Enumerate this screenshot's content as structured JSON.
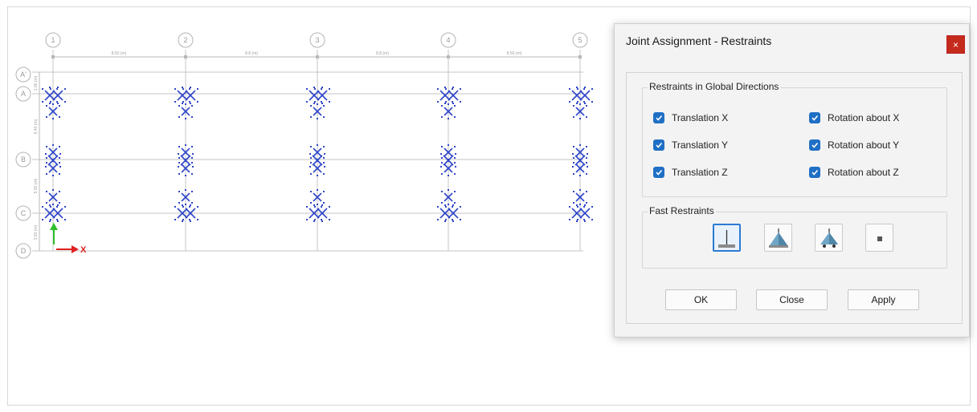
{
  "grid": {
    "columns": [
      "1",
      "2",
      "3",
      "4",
      "5"
    ],
    "rows": [
      "A'",
      "A",
      "B",
      "C",
      "D"
    ],
    "spans": [
      "8.50 (m)",
      "8.8 (m)",
      "8.8 (m)",
      "8.50 (m)"
    ],
    "row_spans": [
      "1.00 (m)",
      "6.40 (m)",
      "5.50 (m)",
      "3.50 (m)"
    ],
    "axis_x": "X"
  },
  "dialog": {
    "title": "Joint Assignment - Restraints",
    "close_glyph": "×",
    "group_global": "Restraints in Global Directions",
    "checks": [
      {
        "label": "Translation  X",
        "checked": true
      },
      {
        "label": "Translation  Y",
        "checked": true
      },
      {
        "label": "Translation  Z",
        "checked": true
      },
      {
        "label": "Rotation about  X",
        "checked": true
      },
      {
        "label": "Rotation about  Y",
        "checked": true
      },
      {
        "label": "Rotation about  Z",
        "checked": true
      }
    ],
    "group_fast": "Fast Restraints",
    "fast_tools": [
      "fixed-support-icon",
      "pinned-support-icon",
      "roller-support-icon",
      "free-joint-icon"
    ],
    "buttons": {
      "ok": "OK",
      "close": "Close",
      "apply": "Apply"
    },
    "accent": "#1f6fc5",
    "close_color": "#c42b1c"
  },
  "support_color": "#2f45c9"
}
